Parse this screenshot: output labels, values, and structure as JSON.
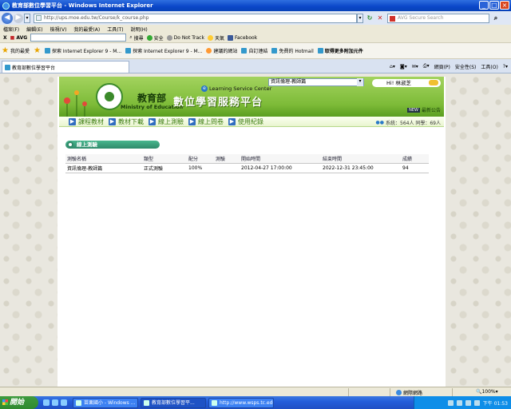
{
  "window": {
    "title": "教育部數位學習平台 - Windows Internet Explorer"
  },
  "browser": {
    "address": "http://ups.moe.edu.tw/Course/k_course.php",
    "search_placeholder": "AVG Secure Search",
    "menu": [
      "檔案(F)",
      "編輯(E)",
      "檢視(V)",
      "我的最愛(A)",
      "工具(T)",
      "說明(H)"
    ],
    "avg_toolbar": {
      "logo": "AVG",
      "search_label": "搜尋",
      "safe": "安全",
      "dnt": "Do Not Track",
      "weather": "天氣",
      "facebook": "Facebook"
    },
    "favorites": {
      "label": "我的最愛",
      "items": [
        "探索 Internet Explorer 9 - M...",
        "探索 Internet Explorer 9 - M...",
        "建議的網站",
        "自訂連結",
        "免費的 Hotmail",
        "取得更多附加元件"
      ]
    },
    "tab": "教育部數位學習平台",
    "commands": [
      "網頁(P)",
      "安全性(S)",
      "工具(O)"
    ]
  },
  "site": {
    "ministry_zh": "教育部",
    "ministry_en": "Ministry of Education",
    "lsc": "Learning Service Center",
    "platform": "數位學習服務平台",
    "course_select": "資訊倫理-教師篇",
    "greeting": "Hi! 林淑芝",
    "news": "最新公告",
    "nav": [
      "課程教材",
      "教材下載",
      "線上測驗",
      "線上問卷",
      "使用紀錄"
    ],
    "counter": "系統：564人 同學：69人",
    "section_title": "線上測驗",
    "table": {
      "headers": [
        "測驗名稱",
        "類型",
        "配分",
        "測驗",
        "開始時間",
        "結束時間",
        "成績"
      ],
      "rows": [
        [
          "資訊倫理-教師篇",
          "正式測驗",
          "100%",
          "",
          "2012-04-27 17:00:00",
          "2022-12-31 23:45:00",
          "94"
        ]
      ]
    }
  },
  "statusbar": {
    "zone": "網際網路",
    "zoom": "100%"
  },
  "taskbar": {
    "start": "開始",
    "tasks": [
      "苗栗國小 - Windows ...",
      "教育部數位學習平...",
      "http://www.wsps.tc.edu..."
    ],
    "clock": "下午 01:53"
  }
}
